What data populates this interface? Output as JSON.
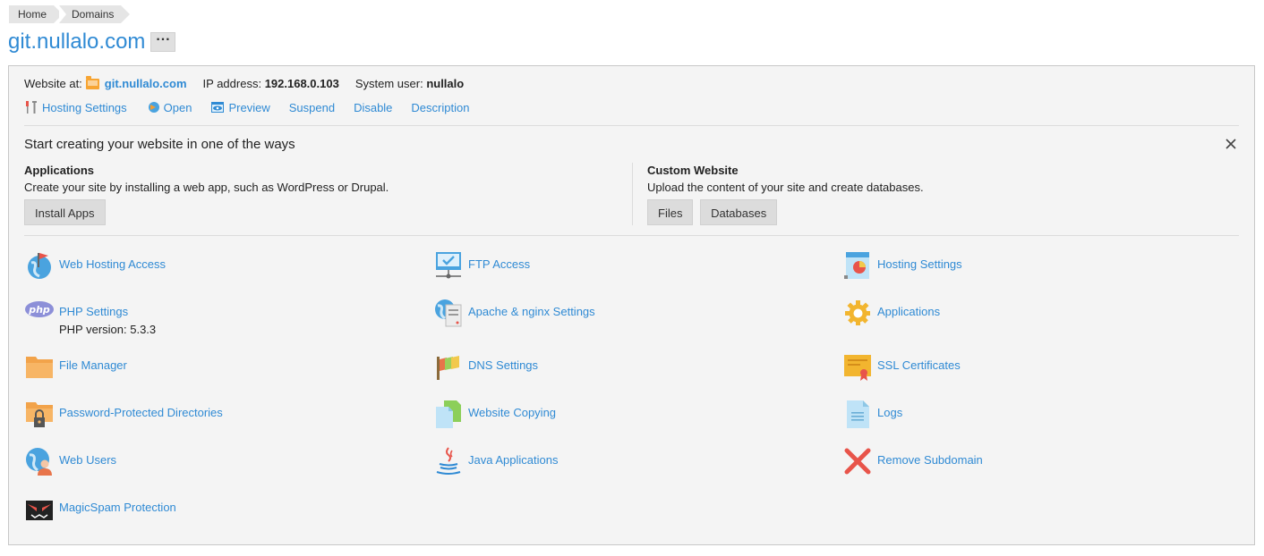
{
  "breadcrumb": {
    "home": "Home",
    "domains": "Domains"
  },
  "page": {
    "title": "git.nullalo.com",
    "more": "···"
  },
  "info": {
    "website_label": "Website at:",
    "website_value": "git.nullalo.com",
    "ip_label": "IP address:",
    "ip_value": "192.168.0.103",
    "user_label": "System user:",
    "user_value": "nullalo"
  },
  "actions": {
    "hosting_settings": "Hosting Settings",
    "open": "Open",
    "preview": "Preview",
    "suspend": "Suspend",
    "disable": "Disable",
    "description": "Description"
  },
  "start": {
    "title": "Start creating your website in one of the ways",
    "applications": {
      "heading": "Applications",
      "text": "Create your site by installing a web app, such as WordPress or Drupal.",
      "install_btn": "Install Apps"
    },
    "custom": {
      "heading": "Custom Website",
      "text": "Upload the content of your site and create databases.",
      "files_btn": "Files",
      "databases_btn": "Databases"
    }
  },
  "tools": {
    "web_hosting_access": "Web Hosting Access",
    "ftp_access": "FTP Access",
    "hosting_settings": "Hosting Settings",
    "php_settings": "PHP Settings",
    "php_version": "PHP version: 5.3.3",
    "apache_nginx": "Apache & nginx Settings",
    "applications": "Applications",
    "file_manager": "File Manager",
    "dns_settings": "DNS Settings",
    "ssl_certificates": "SSL Certificates",
    "password_dirs": "Password-Protected Directories",
    "website_copying": "Website Copying",
    "logs": "Logs",
    "web_users": "Web Users",
    "java_applications": "Java Applications",
    "remove_subdomain": "Remove Subdomain",
    "magicspam": "MagicSpam Protection"
  },
  "icons": {
    "php_badge": "php",
    "cert_ribbon": "ribbon-icon"
  },
  "colors": {
    "link": "#2f8ad4",
    "folder": "#f7a533",
    "remove": "#e8544a"
  }
}
